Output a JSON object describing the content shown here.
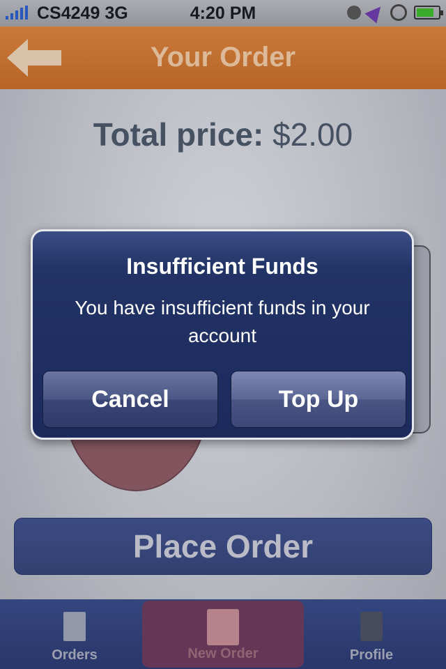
{
  "status_bar": {
    "carrier": "CS4249",
    "network": "3G",
    "time": "4:20 PM"
  },
  "nav": {
    "title": "Your Order"
  },
  "order": {
    "total_label": "Total price:",
    "total_value": "$2.00"
  },
  "place_order": {
    "label": "Place Order"
  },
  "alert": {
    "title": "Insufficient Funds",
    "message": "You have insufficient funds in your account",
    "cancel_label": "Cancel",
    "confirm_label": "Top Up"
  },
  "tab_bar": {
    "tabs": [
      {
        "label": "Orders",
        "icon": "receipt-icon"
      },
      {
        "label": "New Order",
        "icon": "food-bowl-icon",
        "selected": true
      },
      {
        "label": "Profile",
        "icon": "person-icon"
      }
    ]
  },
  "colors": {
    "nav_accent": "#c7732f",
    "primary": "#354478",
    "battery_level": "#3fb52e"
  }
}
